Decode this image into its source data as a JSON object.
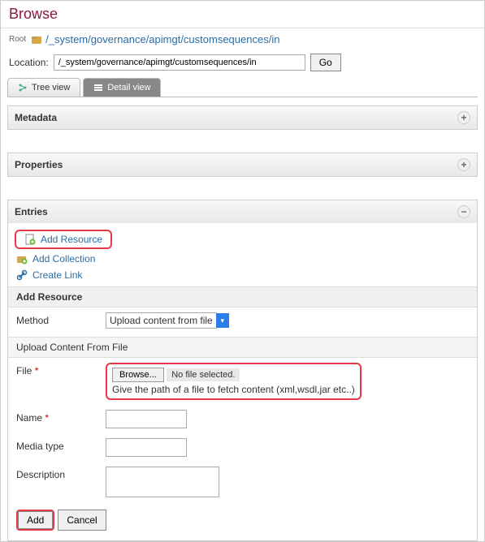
{
  "header": {
    "title": "Browse"
  },
  "breadcrumb": {
    "root_label": "Root",
    "path": "/_system/governance/apimgt/customsequences/in"
  },
  "location": {
    "label": "Location:",
    "value": "/_system/governance/apimgt/customsequences/in",
    "go_label": "Go"
  },
  "tabs": {
    "tree": "Tree view",
    "detail": "Detail view"
  },
  "sections": {
    "metadata": {
      "title": "Metadata"
    },
    "properties": {
      "title": "Properties"
    },
    "entries": {
      "title": "Entries",
      "add_resource": "Add Resource",
      "add_collection": "Add Collection",
      "create_link": "Create Link"
    }
  },
  "add_resource_form": {
    "title": "Add Resource",
    "method_label": "Method",
    "method_value": "Upload content from file",
    "upload_header": "Upload Content From File",
    "file_label": "File",
    "browse_label": "Browse...",
    "file_status": "No file selected.",
    "file_hint": "Give the path of a file to fetch content (xml,wsdl,jar etc..)",
    "name_label": "Name",
    "media_label": "Media type",
    "description_label": "Description",
    "add_btn": "Add",
    "cancel_btn": "Cancel"
  }
}
